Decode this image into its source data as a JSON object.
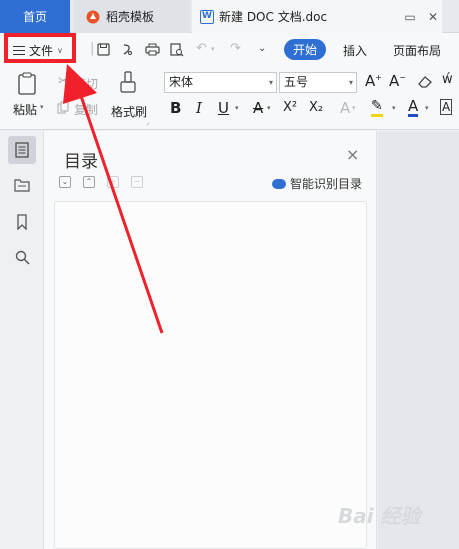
{
  "tabs": {
    "home": "首页",
    "template": "稻壳模板",
    "document": "新建 DOC 文档.doc"
  },
  "menu": {
    "file": "文件",
    "start": "开始",
    "insert": "插入",
    "layout": "页面布局"
  },
  "ribbon": {
    "paste": "粘贴",
    "cut": "剪切",
    "copy": "复制",
    "format_painter": "格式刷",
    "font_name": "宋体",
    "font_size": "五号",
    "bold": "B",
    "italic": "I",
    "underline": "U",
    "superscript": "X²",
    "subscript": "X₂",
    "grow": "A⁺",
    "shrink": "A⁻"
  },
  "toc_panel": {
    "title": "目录",
    "close": "×",
    "smart_detect": "智能识别目录"
  },
  "annotation": {
    "highlight_color": "#f0212b"
  },
  "watermark": "Bai 经验",
  "colors": {
    "accent": "#2f6fd3",
    "highlight": "#f0212b"
  }
}
